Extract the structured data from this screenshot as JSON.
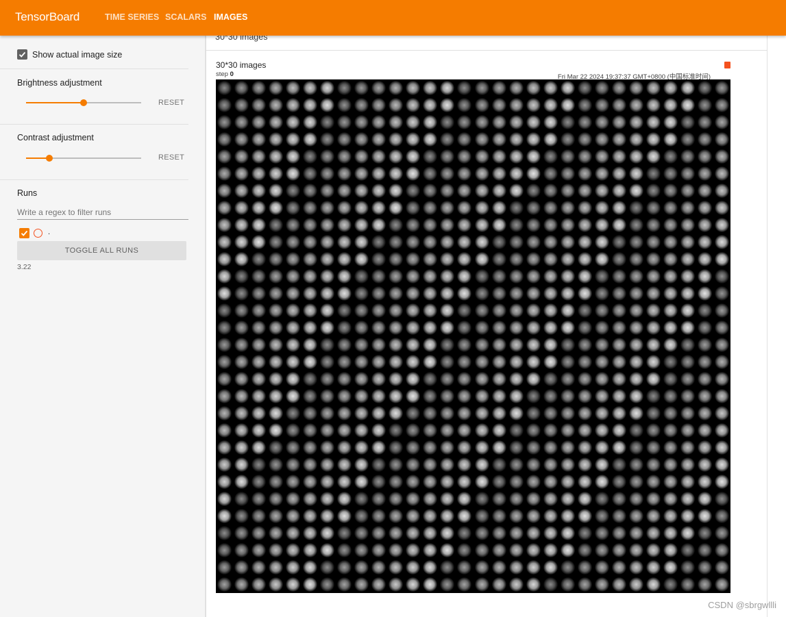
{
  "header": {
    "brand": "TensorBoard",
    "tabs": [
      {
        "label": "TIME SERIES",
        "active": false
      },
      {
        "label": "SCALARS",
        "active": false
      },
      {
        "label": "IMAGES",
        "active": true
      }
    ],
    "accent_color": "#f57c00"
  },
  "sidebar": {
    "show_actual_size": {
      "label": "Show actual image size",
      "checked": true
    },
    "brightness": {
      "label": "Brightness adjustment",
      "reset_label": "RESET",
      "value": 0.5
    },
    "contrast": {
      "label": "Contrast adjustment",
      "reset_label": "RESET",
      "value": 0.2
    },
    "runs": {
      "title": "Runs",
      "filter_placeholder": "Write a regex to filter runs",
      "run_name": ".",
      "run_checked": true,
      "toggle_label": "TOGGLE ALL RUNS",
      "version": "3.22",
      "run_color": "#f4511e"
    }
  },
  "main": {
    "group_title": "30*30 images",
    "card": {
      "title": "30*30 images",
      "step_prefix": "step",
      "step_value": "0",
      "wall_time": "Fri Mar 22 2024 19:37:37 GMT+0800 (中国标准时间)",
      "grid_rows": 30,
      "grid_cols": 30
    }
  },
  "watermark": "CSDN @sbrgwllli"
}
